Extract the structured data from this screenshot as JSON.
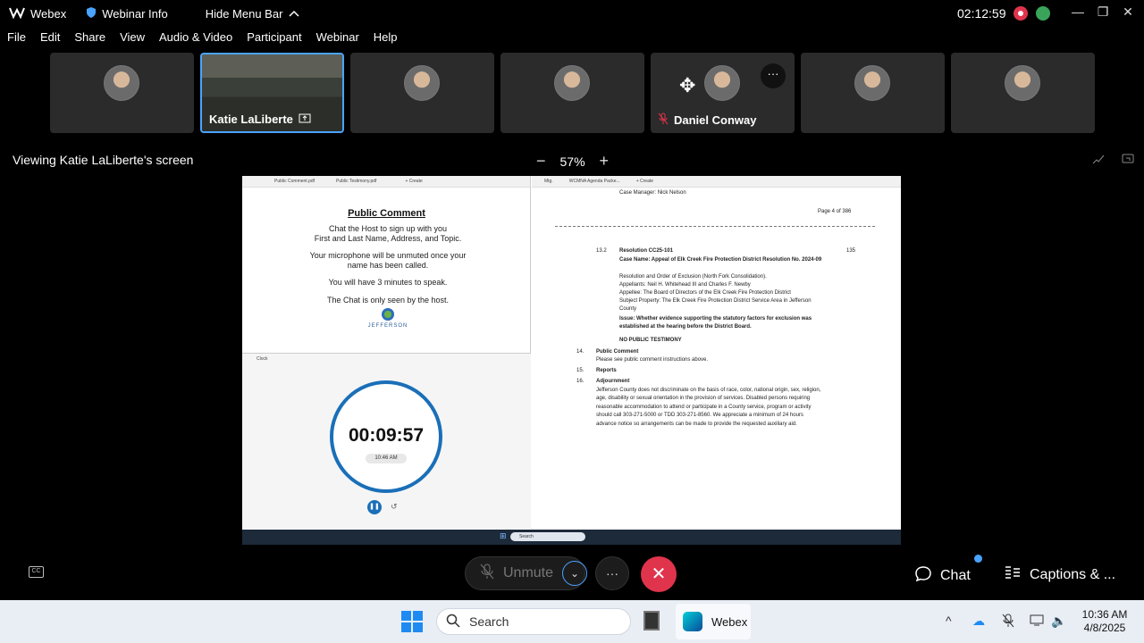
{
  "titlebar": {
    "app_name": "Webex",
    "webinar_info": "Webinar Info",
    "hide_menu": "Hide Menu Bar",
    "clock": "02:12:59"
  },
  "menu": [
    "File",
    "Edit",
    "Share",
    "View",
    "Audio & Video",
    "Participant",
    "Webinar",
    "Help"
  ],
  "participants": {
    "active_name": "Katie LaLiberte",
    "daniel_name": "Daniel Conway"
  },
  "viewing": "Viewing Katie LaLiberte's screen",
  "zoom": {
    "minus": "−",
    "level": "57%",
    "plus": "+"
  },
  "shared": {
    "left_tabs": [
      "Public Comment.pdf",
      "Public Testimony.pdf",
      "+ Create"
    ],
    "pc_title": "Public Comment",
    "pc_line1": "Chat the Host to sign up with you",
    "pc_line2": "First and Last Name, Address, and Topic.",
    "pc_line3": "Your microphone will be unmuted once your",
    "pc_line4": "name has been called.",
    "pc_line5": "You will have 3 minutes to speak.",
    "pc_line6": "The Chat is only seen by the host.",
    "logo_text": "JEFFERSON",
    "clock_title": "Clock",
    "timer": "00:09:57",
    "alarm": "10:46 AM",
    "right_tabs": [
      "Mtg.",
      "WCMNA Agenda Packe...",
      "+ Create"
    ],
    "case_manager": "Case Manager: Nick Nelson",
    "page": "Page 4 of 386",
    "item_num": "13.2",
    "item_title": "Resolution CC25-101",
    "item_page": "135",
    "case_name": "Case Name: Appeal of Elk Creek Fire Protection District Resolution No. 2024-09",
    "res_order": "Resolution and Order of Exclusion (North Fork Consolidation).",
    "appellants": "Appellants: Neil H. Whitehead III and Charles F. Newby",
    "appellee": "Appellee: The Board of Directors of the Elk Creek Fire Protection District",
    "subject": "Subject Property: The Elk Creek Fire Protection District Service Area in Jefferson County",
    "issue": "Issue: Whether evidence supporting the statutory factors for exclusion was established at the hearing before the District Board.",
    "no_testimony": "NO PUBLIC TESTIMONY",
    "n14": "14.",
    "public_comment": "Public Comment",
    "pc_instr": "Please see public comment instructions above.",
    "n15": "15.",
    "reports": "Reports",
    "n16": "16.",
    "adjournment": "Adjournment",
    "adj_text": "Jefferson County does not discriminate on the basis of race, color, national origin, sex, religion, age, disability or sexual orientation in the provision of services. Disabled persons requiring reasonable accommodation to attend or participate in a County service, program or activity should call 303-271-5000 or TDD 303-271-8560. We appreciate a minimum of 24 hours advance notice so arrangements can be made to provide the requested auxiliary aid.",
    "taskbar_search": "Search"
  },
  "controls": {
    "unmute": "Unmute",
    "chat": "Chat",
    "captions": "Captions & ..."
  },
  "taskbar": {
    "search": "Search",
    "webex": "Webex",
    "time": "10:36 AM",
    "date": "4/8/2025"
  },
  "colors": {
    "accent": "#4aa3ff",
    "leave": "#e0344c",
    "timer_ring": "#1a6fb8"
  }
}
